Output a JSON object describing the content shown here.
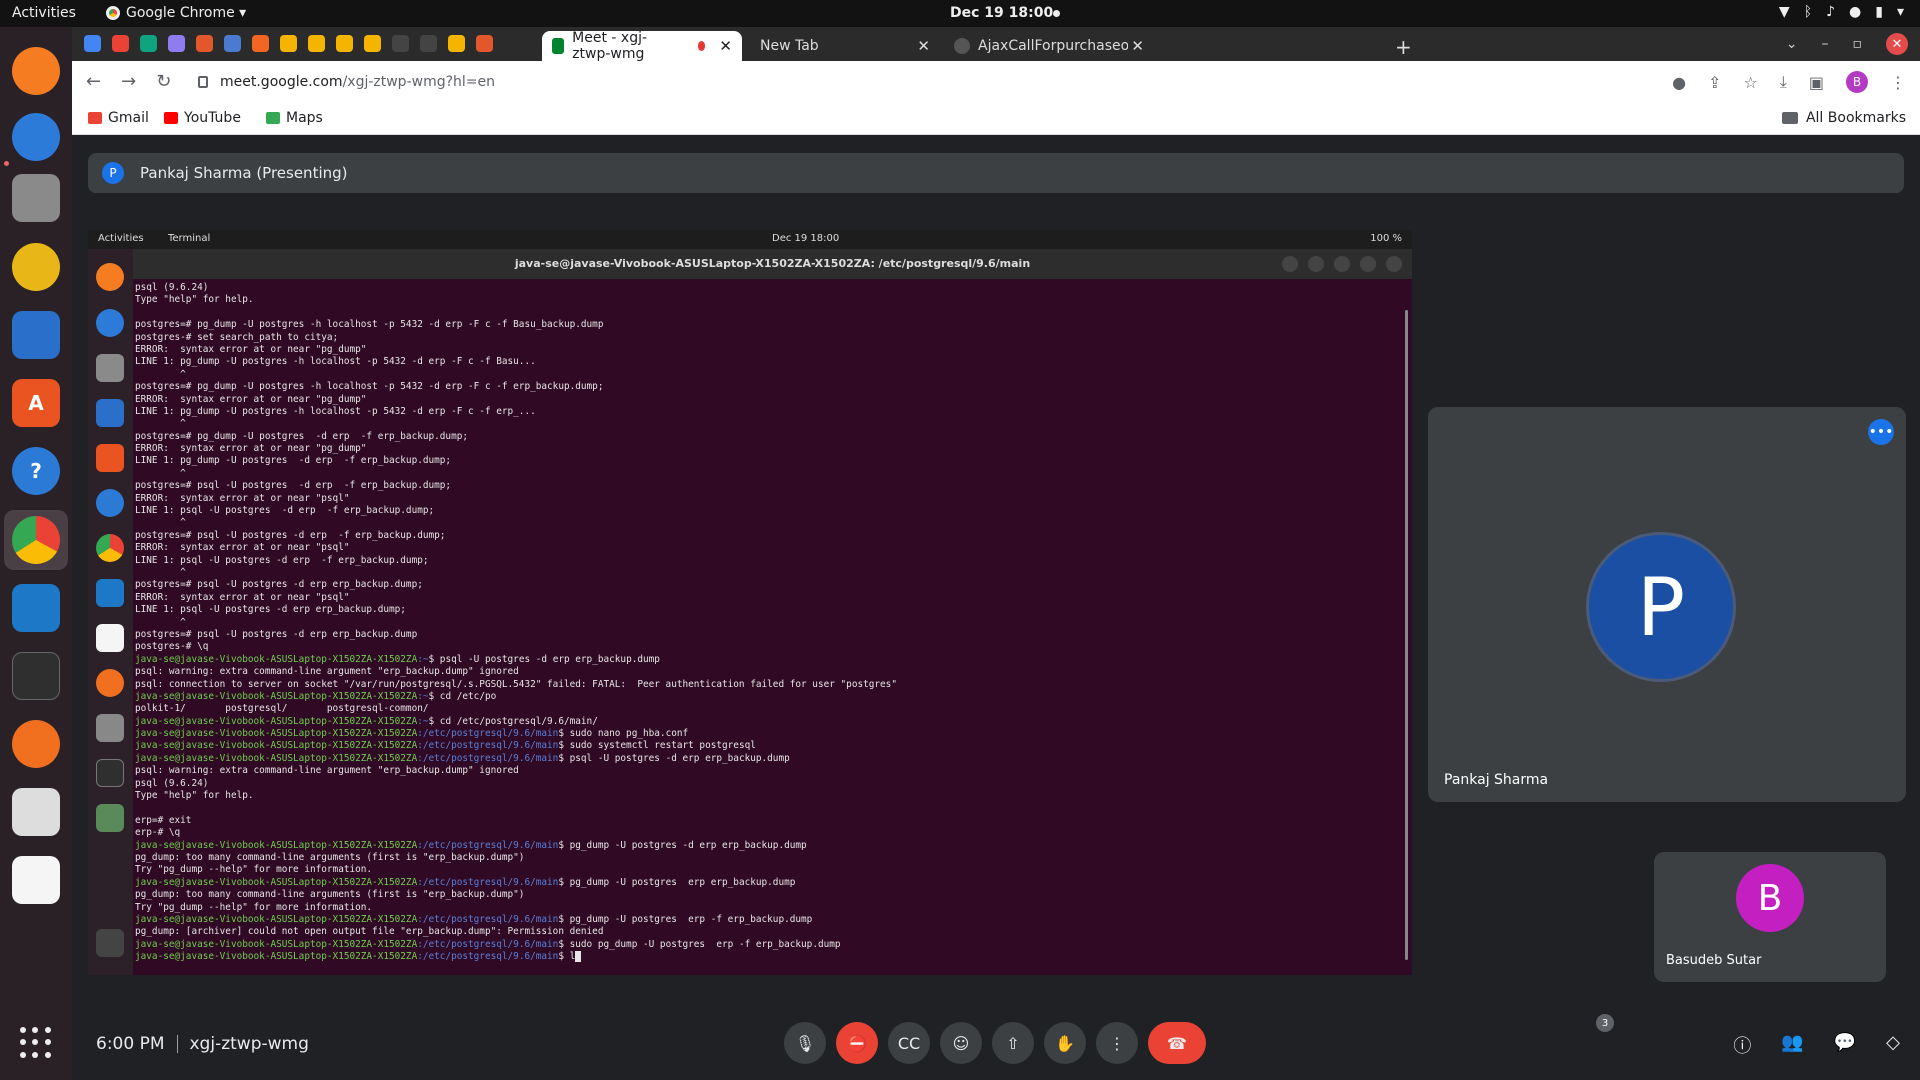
{
  "topbar": {
    "activities": "Activities",
    "app_name": "Google Chrome ▾",
    "clock": "Dec 19  18:00"
  },
  "tabs": [
    {
      "label": "Meet - xgj-ztwp-wmg"
    },
    {
      "label": "New Tab"
    },
    {
      "label": "AjaxCallForpurchaseorde"
    }
  ],
  "address": {
    "host": "meet.google.com",
    "path": "/xgj-ztwp-wmg?hl=en"
  },
  "toolbar": {
    "profile_initial": "B"
  },
  "bookmarks": {
    "items": [
      "Gmail",
      "YouTube",
      "Maps"
    ],
    "all": "All Bookmarks"
  },
  "meet": {
    "presenter_initial": "P",
    "presenter_label": "Pankaj Sharma (Presenting)",
    "meeting_time": "6:00 PM",
    "meeting_code": "xgj-ztwp-wmg",
    "participant_count": "3",
    "participants": [
      {
        "initial": "P",
        "name": "Pankaj Sharma",
        "color": "#1a4fa3"
      },
      {
        "initial": "B",
        "name": "Basudeb Sutar",
        "color": "#c31fc1"
      }
    ]
  },
  "shared": {
    "topbar_activities": "Activities",
    "topbar_app": "Terminal",
    "topbar_clock": "Dec 19  18:00",
    "topbar_battery": "100 %",
    "window_title": "java-se@javase-Vivobook-ASUSLaptop-X1502ZA-X1502ZA: /etc/postgresql/9.6/main",
    "lines": [
      "psql (9.6.24)",
      "Type \"help\" for help.",
      "",
      "postgres=# pg_dump -U postgres -h localhost -p 5432 -d erp -F c -f Basu_backup.dump",
      "postgres-# set search_path to citya;",
      "ERROR:  syntax error at or near \"pg_dump\"",
      "LINE 1: pg_dump -U postgres -h localhost -p 5432 -d erp -F c -f Basu...",
      "        ^",
      "postgres=# pg_dump -U postgres -h localhost -p 5432 -d erp -F c -f erp_backup.dump;",
      "ERROR:  syntax error at or near \"pg_dump\"",
      "LINE 1: pg_dump -U postgres -h localhost -p 5432 -d erp -F c -f erp_...",
      "        ^",
      "postgres=# pg_dump -U postgres  -d erp  -f erp_backup.dump;",
      "ERROR:  syntax error at or near \"pg_dump\"",
      "LINE 1: pg_dump -U postgres  -d erp  -f erp_backup.dump;",
      "        ^",
      "postgres=# psql -U postgres  -d erp  -f erp_backup.dump;",
      "ERROR:  syntax error at or near \"psql\"",
      "LINE 1: psql -U postgres  -d erp  -f erp_backup.dump;",
      "        ^",
      "postgres=# psql -U postgres -d erp  -f erp_backup.dump;",
      "ERROR:  syntax error at or near \"psql\"",
      "LINE 1: psql -U postgres -d erp  -f erp_backup.dump;",
      "        ^",
      "postgres=# psql -U postgres -d erp erp_backup.dump;",
      "ERROR:  syntax error at or near \"psql\"",
      "LINE 1: psql -U postgres -d erp erp_backup.dump;",
      "        ^",
      "postgres=# psql -U postgres -d erp erp_backup.dump",
      "postgres-# \\q"
    ],
    "prompt": "java-se@javase-Vivobook-ASUSLaptop-X1502ZA-X1502ZA",
    "prompt_path": "/etc/postgresql/9.6/main",
    "tail": [
      {
        "p": "java-se@javase-Vivobook-ASUSLaptop-X1502ZA-X1502ZA",
        "d": ":~",
        "c": "$ psql -U postgres -d erp erp_backup.dump"
      },
      {
        "t": "psql: warning: extra command-line argument \"erp_backup.dump\" ignored"
      },
      {
        "t": "psql: connection to server on socket \"/var/run/postgresql/.s.PGSQL.5432\" failed: FATAL:  Peer authentication failed for user \"postgres\""
      },
      {
        "p": "java-se@javase-Vivobook-ASUSLaptop-X1502ZA-X1502ZA",
        "d": ":~",
        "c": "$ cd /etc/po"
      },
      {
        "t": "polkit-1/       postgresql/       postgresql-common/"
      },
      {
        "p": "java-se@javase-Vivobook-ASUSLaptop-X1502ZA-X1502ZA",
        "d": ":~",
        "c": "$ cd /etc/postgresql/9.6/main/"
      },
      {
        "p": "java-se@javase-Vivobook-ASUSLaptop-X1502ZA-X1502ZA",
        "d": ":/etc/postgresql/9.6/main",
        "c": "$ sudo nano pg_hba.conf"
      },
      {
        "p": "java-se@javase-Vivobook-ASUSLaptop-X1502ZA-X1502ZA",
        "d": ":/etc/postgresql/9.6/main",
        "c": "$ sudo systemctl restart postgresql"
      },
      {
        "p": "java-se@javase-Vivobook-ASUSLaptop-X1502ZA-X1502ZA",
        "d": ":/etc/postgresql/9.6/main",
        "c": "$ psql -U postgres -d erp erp_backup.dump"
      },
      {
        "t": "psql: warning: extra command-line argument \"erp_backup.dump\" ignored"
      },
      {
        "t": "psql (9.6.24)"
      },
      {
        "t": "Type \"help\" for help."
      },
      {
        "t": ""
      },
      {
        "t": "erp=# exit"
      },
      {
        "t": "erp-# \\q"
      },
      {
        "p": "java-se@javase-Vivobook-ASUSLaptop-X1502ZA-X1502ZA",
        "d": ":/etc/postgresql/9.6/main",
        "c": "$ pg_dump -U postgres -d erp erp_backup.dump"
      },
      {
        "t": "pg_dump: too many command-line arguments (first is \"erp_backup.dump\")"
      },
      {
        "t": "Try \"pg_dump --help\" for more information."
      },
      {
        "p": "java-se@javase-Vivobook-ASUSLaptop-X1502ZA-X1502ZA",
        "d": ":/etc/postgresql/9.6/main",
        "c": "$ pg_dump -U postgres  erp erp_backup.dump"
      },
      {
        "t": "pg_dump: too many command-line arguments (first is \"erp_backup.dump\")"
      },
      {
        "t": "Try \"pg_dump --help\" for more information."
      },
      {
        "p": "java-se@javase-Vivobook-ASUSLaptop-X1502ZA-X1502ZA",
        "d": ":/etc/postgresql/9.6/main",
        "c": "$ pg_dump -U postgres  erp -f erp_backup.dump"
      },
      {
        "t": "pg_dump: [archiver] could not open output file \"erp_backup.dump\": Permission denied"
      },
      {
        "p": "java-se@javase-Vivobook-ASUSLaptop-X1502ZA-X1502ZA",
        "d": ":/etc/postgresql/9.6/main",
        "c": "$ sudo pg_dump -U postgres  erp -f erp_backup.dump"
      },
      {
        "p": "java-se@javase-Vivobook-ASUSLaptop-X1502ZA-X1502ZA",
        "d": ":/etc/postgresql/9.6/main",
        "c": "$ l",
        "cursor": true
      }
    ]
  },
  "colors": {
    "terminal_bg": "#300a24",
    "prompt_green": "#6fcf4a",
    "path_blue": "#5a7fd6",
    "end_call_red": "#ea4335"
  }
}
